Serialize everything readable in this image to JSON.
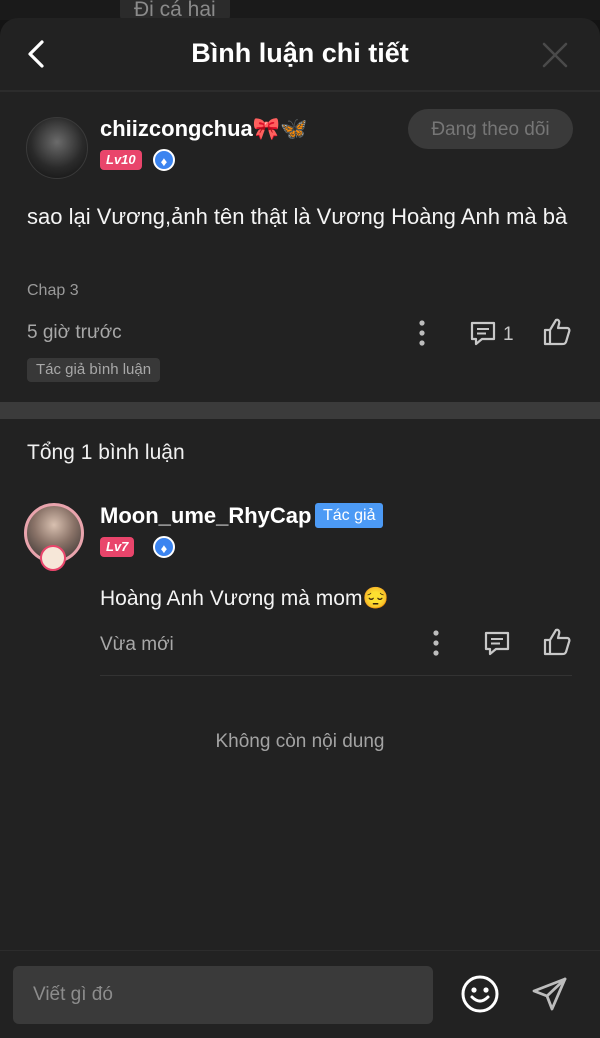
{
  "background": {
    "peek_text": "Đi cá hai"
  },
  "header": {
    "title": "Bình luận chi tiết"
  },
  "comment": {
    "username": "chiizcongchua🎀🦋",
    "level": "Lv10",
    "follow_label": "Đang theo dõi",
    "text": "sao lại Vương,ảnh tên thật là Vương Hoàng Anh mà bà",
    "chapter": "Chap 3",
    "time": "5 giờ trước",
    "reply_count": "1",
    "author_tag": "Tác giả bình luận"
  },
  "replies_header": "Tổng 1 bình luận",
  "reply": {
    "username": "Moon_ume_RhyCap",
    "author_badge": "Tác giả",
    "level": "Lv7",
    "text": "Hoàng Anh Vương mà mom😔",
    "time": "Vừa mới"
  },
  "end_text": "Không còn nội dung",
  "composer": {
    "placeholder": "Viết gì đó"
  },
  "colors": {
    "level_badge": "#e9456b",
    "author_badge": "#4c9af5",
    "shield": "#3b84f0"
  },
  "icons": [
    "back-arrow-icon",
    "close-icon",
    "shield-icon",
    "more-vertical-icon",
    "comment-icon",
    "like-icon",
    "emoji-icon",
    "send-icon"
  ]
}
